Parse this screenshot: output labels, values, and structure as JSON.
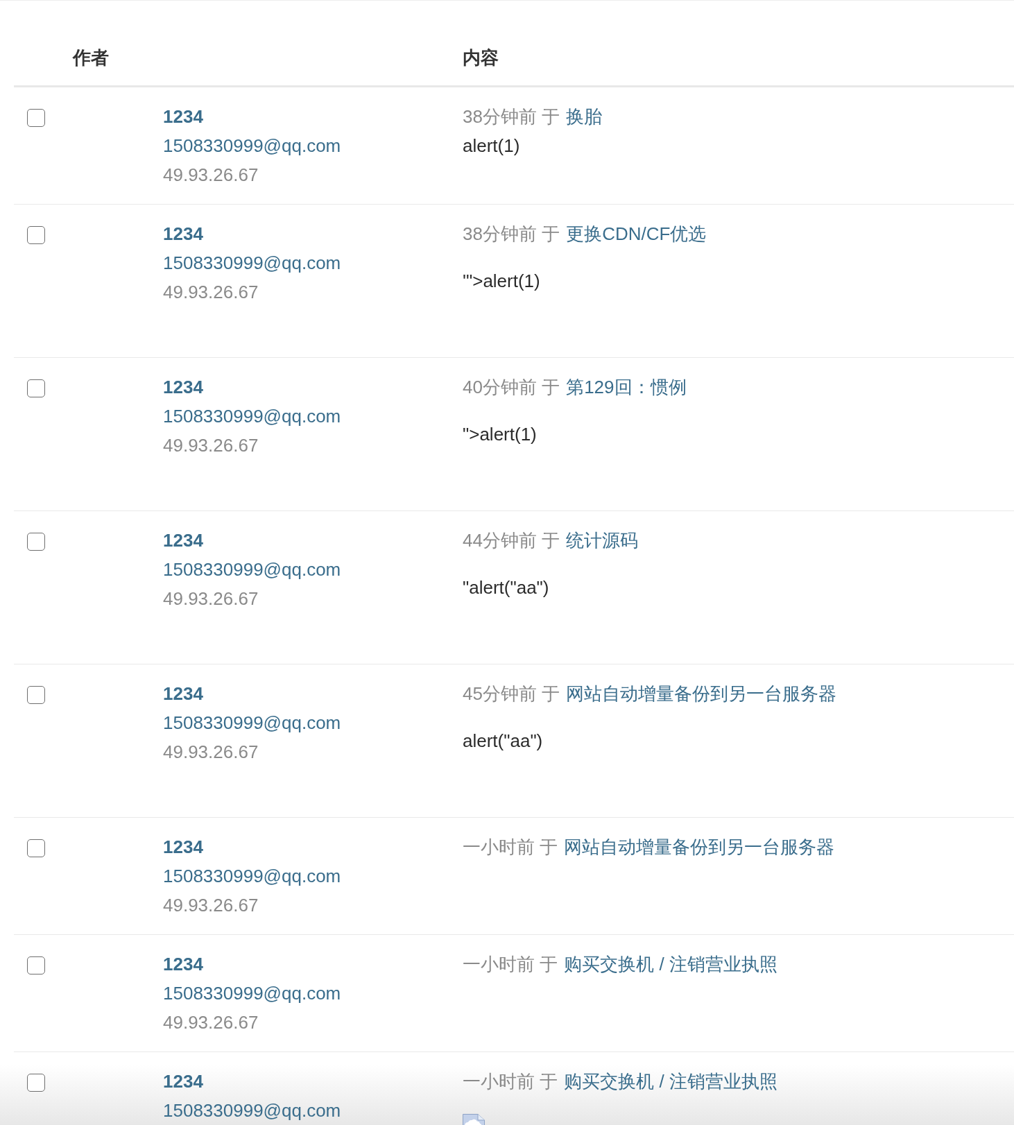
{
  "table": {
    "columns": [
      "作者",
      "内容"
    ],
    "rows": [
      {
        "checked": false,
        "author": {
          "name": "1234",
          "email": "1508330999@qq.com",
          "ip": "49.93.26.67"
        },
        "submitted": "38分钟前 于",
        "post": "换胎",
        "body": {
          "kind": "inline",
          "text": "alert(1)"
        }
      },
      {
        "checked": false,
        "author": {
          "name": "1234",
          "email": "1508330999@qq.com",
          "ip": "49.93.26.67"
        },
        "submitted": "38分钟前 于",
        "post": "更换CDN/CF优选",
        "body": {
          "kind": "paragraph",
          "text": "'\">alert(1)"
        }
      },
      {
        "checked": false,
        "author": {
          "name": "1234",
          "email": "1508330999@qq.com",
          "ip": "49.93.26.67"
        },
        "submitted": "40分钟前 于",
        "post": "第129回：惯例",
        "body": {
          "kind": "paragraph",
          "text": "\">alert(1)"
        }
      },
      {
        "checked": false,
        "author": {
          "name": "1234",
          "email": "1508330999@qq.com",
          "ip": "49.93.26.67"
        },
        "submitted": "44分钟前 于",
        "post": "统计源码",
        "body": {
          "kind": "paragraph",
          "text": "\"alert(\"aa\")"
        }
      },
      {
        "checked": false,
        "author": {
          "name": "1234",
          "email": "1508330999@qq.com",
          "ip": "49.93.26.67"
        },
        "submitted": "45分钟前 于",
        "post": "网站自动增量备份到另一台服务器",
        "body": {
          "kind": "paragraph",
          "text": "alert(\"aa\")"
        }
      },
      {
        "checked": false,
        "author": {
          "name": "1234",
          "email": "1508330999@qq.com",
          "ip": "49.93.26.67"
        },
        "submitted": "一小时前 于",
        "post": "网站自动增量备份到另一台服务器"
      },
      {
        "checked": false,
        "author": {
          "name": "1234",
          "email": "1508330999@qq.com",
          "ip": "49.93.26.67"
        },
        "submitted": "一小时前 于",
        "post": "购买交换机 / 注销营业执照"
      },
      {
        "checked": false,
        "author": {
          "name": "1234",
          "email": "1508330999@qq.com"
        },
        "submitted": "一小时前 于",
        "post": "购买交换机 / 注销营业执照",
        "body": {
          "kind": "image"
        }
      }
    ]
  }
}
